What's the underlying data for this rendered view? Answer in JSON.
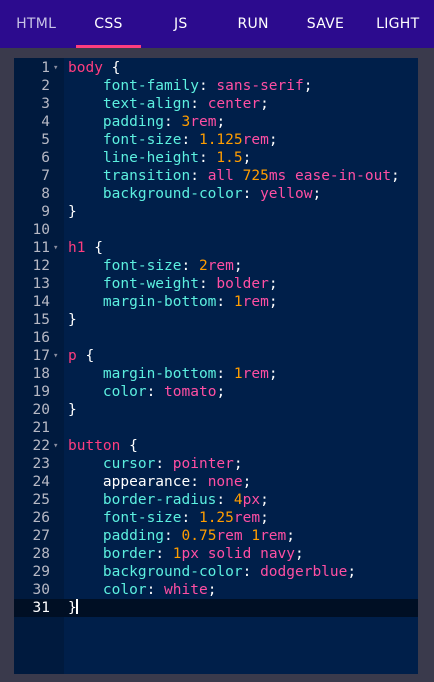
{
  "tabs": [
    {
      "label": "HTML",
      "active": false
    },
    {
      "label": "CSS",
      "active": true
    },
    {
      "label": "JS",
      "active": false
    },
    {
      "label": "RUN",
      "active": false
    },
    {
      "label": "SAVE",
      "active": false
    },
    {
      "label": "LIGHT",
      "active": false
    }
  ],
  "colors": {
    "selector": "#ff3d7f",
    "property": "#5cf0e0",
    "value": "#ff4fa3",
    "number": "#ff9d00",
    "punctuation": "#ffffff"
  },
  "editor": {
    "active_line": 31,
    "lines": [
      {
        "n": "1",
        "fold": true,
        "t": [
          [
            "selector",
            "body"
          ],
          [
            "p",
            " {"
          ]
        ]
      },
      {
        "n": "2",
        "t": [
          [
            "p",
            "    "
          ],
          [
            "property",
            "font-family"
          ],
          [
            "p",
            ": "
          ],
          [
            "value",
            "sans-serif"
          ],
          [
            "p",
            ";"
          ]
        ]
      },
      {
        "n": "3",
        "t": [
          [
            "p",
            "    "
          ],
          [
            "property",
            "text-align"
          ],
          [
            "p",
            ": "
          ],
          [
            "value",
            "center"
          ],
          [
            "p",
            ";"
          ]
        ]
      },
      {
        "n": "4",
        "t": [
          [
            "p",
            "    "
          ],
          [
            "property",
            "padding"
          ],
          [
            "p",
            ": "
          ],
          [
            "number",
            "3"
          ],
          [
            "value",
            "rem"
          ],
          [
            "p",
            ";"
          ]
        ]
      },
      {
        "n": "5",
        "t": [
          [
            "p",
            "    "
          ],
          [
            "property",
            "font-size"
          ],
          [
            "p",
            ": "
          ],
          [
            "number",
            "1.125"
          ],
          [
            "value",
            "rem"
          ],
          [
            "p",
            ";"
          ]
        ]
      },
      {
        "n": "6",
        "t": [
          [
            "p",
            "    "
          ],
          [
            "property",
            "line-height"
          ],
          [
            "p",
            ": "
          ],
          [
            "number",
            "1.5"
          ],
          [
            "p",
            ";"
          ]
        ]
      },
      {
        "n": "7",
        "t": [
          [
            "p",
            "    "
          ],
          [
            "property",
            "transition"
          ],
          [
            "p",
            ": "
          ],
          [
            "value",
            "all "
          ],
          [
            "number",
            "725"
          ],
          [
            "value",
            "ms ease-in-out"
          ],
          [
            "p",
            ";"
          ]
        ]
      },
      {
        "n": "8",
        "t": [
          [
            "p",
            "    "
          ],
          [
            "property",
            "background-color"
          ],
          [
            "p",
            ": "
          ],
          [
            "value",
            "yellow"
          ],
          [
            "p",
            ";"
          ]
        ]
      },
      {
        "n": "9",
        "t": [
          [
            "p",
            "}"
          ]
        ]
      },
      {
        "n": "10",
        "t": []
      },
      {
        "n": "11",
        "fold": true,
        "t": [
          [
            "selector",
            "h1"
          ],
          [
            "p",
            " {"
          ]
        ]
      },
      {
        "n": "12",
        "t": [
          [
            "p",
            "    "
          ],
          [
            "property",
            "font-size"
          ],
          [
            "p",
            ": "
          ],
          [
            "number",
            "2"
          ],
          [
            "value",
            "rem"
          ],
          [
            "p",
            ";"
          ]
        ]
      },
      {
        "n": "13",
        "t": [
          [
            "p",
            "    "
          ],
          [
            "property",
            "font-weight"
          ],
          [
            "p",
            ": "
          ],
          [
            "value",
            "bolder"
          ],
          [
            "p",
            ";"
          ]
        ]
      },
      {
        "n": "14",
        "t": [
          [
            "p",
            "    "
          ],
          [
            "property",
            "margin-bottom"
          ],
          [
            "p",
            ": "
          ],
          [
            "number",
            "1"
          ],
          [
            "value",
            "rem"
          ],
          [
            "p",
            ";"
          ]
        ]
      },
      {
        "n": "15",
        "t": [
          [
            "p",
            "}"
          ]
        ]
      },
      {
        "n": "16",
        "t": []
      },
      {
        "n": "17",
        "fold": true,
        "t": [
          [
            "selector",
            "p"
          ],
          [
            "p",
            " {"
          ]
        ]
      },
      {
        "n": "18",
        "t": [
          [
            "p",
            "    "
          ],
          [
            "property",
            "margin-bottom"
          ],
          [
            "p",
            ": "
          ],
          [
            "number",
            "1"
          ],
          [
            "value",
            "rem"
          ],
          [
            "p",
            ";"
          ]
        ]
      },
      {
        "n": "19",
        "t": [
          [
            "p",
            "    "
          ],
          [
            "property",
            "color"
          ],
          [
            "p",
            ": "
          ],
          [
            "value",
            "tomato"
          ],
          [
            "p",
            ";"
          ]
        ]
      },
      {
        "n": "20",
        "t": [
          [
            "p",
            "}"
          ]
        ]
      },
      {
        "n": "21",
        "t": []
      },
      {
        "n": "22",
        "fold": true,
        "t": [
          [
            "selector",
            "button"
          ],
          [
            "p",
            " {"
          ]
        ]
      },
      {
        "n": "23",
        "t": [
          [
            "p",
            "    "
          ],
          [
            "property",
            "cursor"
          ],
          [
            "p",
            ": "
          ],
          [
            "value",
            "pointer"
          ],
          [
            "p",
            ";"
          ]
        ]
      },
      {
        "n": "24",
        "t": [
          [
            "p",
            "    "
          ],
          [
            "p",
            "appearance"
          ],
          [
            "p",
            ": "
          ],
          [
            "value",
            "none"
          ],
          [
            "p",
            ";"
          ]
        ]
      },
      {
        "n": "25",
        "t": [
          [
            "p",
            "    "
          ],
          [
            "property",
            "border-radius"
          ],
          [
            "p",
            ": "
          ],
          [
            "number",
            "4"
          ],
          [
            "value",
            "px"
          ],
          [
            "p",
            ";"
          ]
        ]
      },
      {
        "n": "26",
        "t": [
          [
            "p",
            "    "
          ],
          [
            "property",
            "font-size"
          ],
          [
            "p",
            ": "
          ],
          [
            "number",
            "1.25"
          ],
          [
            "value",
            "rem"
          ],
          [
            "p",
            ";"
          ]
        ]
      },
      {
        "n": "27",
        "t": [
          [
            "p",
            "    "
          ],
          [
            "property",
            "padding"
          ],
          [
            "p",
            ": "
          ],
          [
            "number",
            "0.75"
          ],
          [
            "value",
            "rem "
          ],
          [
            "number",
            "1"
          ],
          [
            "value",
            "rem"
          ],
          [
            "p",
            ";"
          ]
        ]
      },
      {
        "n": "28",
        "t": [
          [
            "p",
            "    "
          ],
          [
            "property",
            "border"
          ],
          [
            "p",
            ": "
          ],
          [
            "number",
            "1"
          ],
          [
            "value",
            "px solid navy"
          ],
          [
            "p",
            ";"
          ]
        ]
      },
      {
        "n": "29",
        "t": [
          [
            "p",
            "    "
          ],
          [
            "property",
            "background-color"
          ],
          [
            "p",
            ": "
          ],
          [
            "value",
            "dodgerblue"
          ],
          [
            "p",
            ";"
          ]
        ]
      },
      {
        "n": "30",
        "t": [
          [
            "p",
            "    "
          ],
          [
            "property",
            "color"
          ],
          [
            "p",
            ": "
          ],
          [
            "value",
            "white"
          ],
          [
            "p",
            ";"
          ]
        ]
      },
      {
        "n": "31",
        "t": [
          [
            "p",
            "}"
          ]
        ]
      }
    ]
  }
}
